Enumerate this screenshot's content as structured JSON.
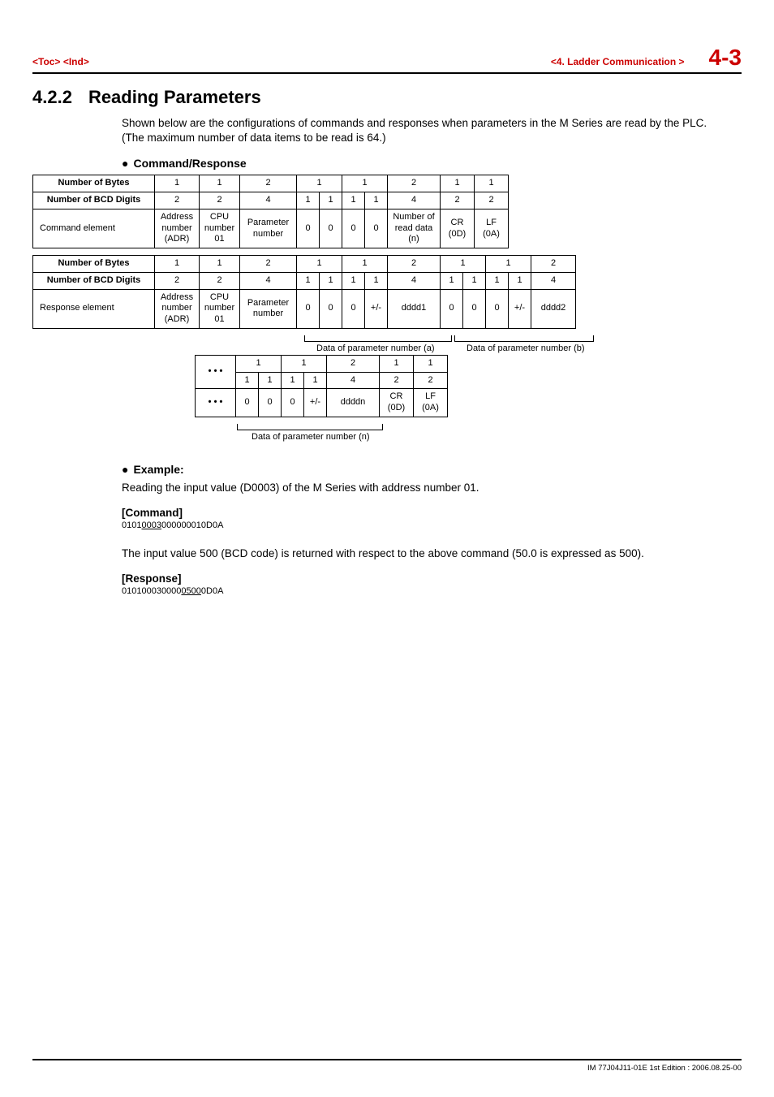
{
  "header": {
    "toc": "<Toc>",
    "ind": "<Ind>",
    "section_label": "<4.  Ladder Communication >",
    "page_num": "4-3"
  },
  "title": {
    "num": "4.2.2",
    "text": "Reading Parameters"
  },
  "intro": "Shown below are the configurations of commands and responses when parameters in the M Series are read by the PLC. (The maximum number of data items to be read is 64.)",
  "heads": {
    "cmd_resp": "Command/Response",
    "example": "Example:"
  },
  "row_labels": {
    "bytes": "Number of Bytes",
    "bcd": "Number of BCD Digits",
    "cmd_elem": "Command element",
    "resp_elem": "Response element"
  },
  "table1": {
    "bytes": [
      "1",
      "1",
      "2",
      "1",
      "1",
      "2",
      "1",
      "1"
    ],
    "bcd": [
      "2",
      "2",
      "4",
      "1",
      "1",
      "1",
      "1",
      "4",
      "2",
      "2"
    ],
    "elem": [
      "Address\nnumber\n(ADR)",
      "CPU\nnumber\n01",
      "Parameter\nnumber",
      "0",
      "0",
      "0",
      "0",
      "Number of\nread data\n(n)",
      "CR",
      "LF"
    ],
    "elem_sub": [
      "",
      "",
      "",
      "",
      "",
      "",
      "",
      "",
      "(0D)",
      "(0A)"
    ]
  },
  "table2": {
    "bytes": [
      "1",
      "1",
      "2",
      "1",
      "1",
      "2",
      "1",
      "1",
      "2"
    ],
    "bcd": [
      "2",
      "2",
      "4",
      "1",
      "1",
      "1",
      "1",
      "4",
      "1",
      "1",
      "1",
      "1",
      "4"
    ],
    "elem": [
      "Address\nnumber\n(ADR)",
      "CPU\nnumber\n01",
      "Parameter\nnumber",
      "0",
      "0",
      "0",
      "+/-",
      "dddd1",
      "0",
      "0",
      "0",
      "+/-",
      "dddd2"
    ]
  },
  "captions": {
    "a": "Data of parameter number (a)",
    "b": "Data of parameter number (b)",
    "n": "Data of parameter number (n)"
  },
  "table3": {
    "dots": "• • •",
    "bytes": [
      "1",
      "1",
      "2",
      "1",
      "1"
    ],
    "bcd": [
      "1",
      "1",
      "1",
      "1",
      "4",
      "2",
      "2"
    ],
    "elem": [
      "0",
      "0",
      "0",
      "+/-",
      "ddddn",
      "CR",
      "LF"
    ],
    "elem_sub": [
      "",
      "",
      "",
      "",
      "",
      "(0D)",
      "(0A)"
    ]
  },
  "example": {
    "intro": "Reading the input value (D0003) of the M Series with address number 01.",
    "cmd_head": "[Command]",
    "cmd_pre": "0101",
    "cmd_underline": "0003",
    "cmd_post": "000000010D0A",
    "resp_note": "The input value 500 (BCD code) is returned with respect to the above command (50.0 is expressed as 500).",
    "resp_head": "[Response]",
    "resp_pre": "010100030000",
    "resp_underline": "0500",
    "resp_post": "0D0A"
  },
  "footer": "IM 77J04J11-01E   1st Edition : 2006.08.25-00"
}
